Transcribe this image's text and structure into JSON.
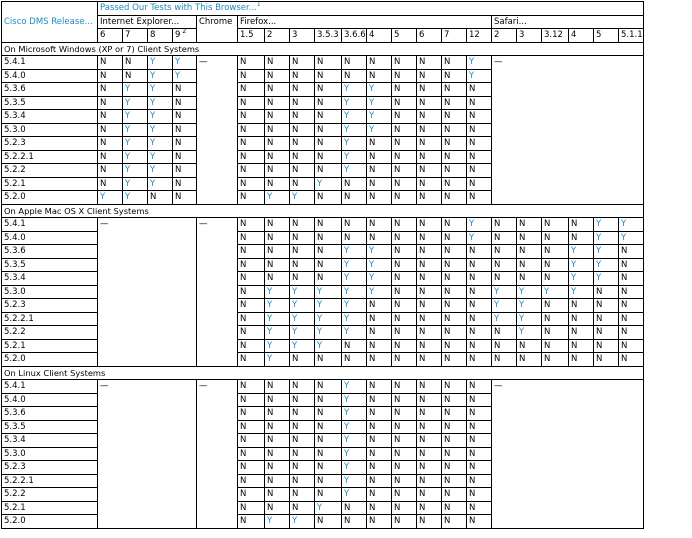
{
  "header": {
    "title": "Passed Our Tests with This Browser...",
    "title_note": "1",
    "release_label": "Cisco DMS Release...",
    "ie_label": "Internet Explorer...",
    "chrome_label": "Chrome",
    "firefox_label": "Firefox...",
    "safari_label": "Safari...",
    "ie_versions": [
      "6",
      "7",
      "8",
      "9"
    ],
    "ie9_note": "2",
    "firefox_versions": [
      "1.5",
      "2",
      "3",
      "3.5.3",
      "3.6.6",
      "4",
      "5",
      "6",
      "7",
      "12"
    ],
    "safari_versions": [
      "2",
      "3",
      "3.12",
      "4",
      "5",
      "5.1.1"
    ]
  },
  "dash": "—",
  "sections": [
    {
      "title": "On Microsoft Windows (XP or 7) Client Systems",
      "rows": [
        {
          "release": "5.4.1",
          "ie": [
            "N",
            "N",
            "Y",
            "Y"
          ],
          "chrome": "—",
          "ff": [
            "N",
            "N",
            "N",
            "N",
            "N",
            "N",
            "N",
            "N",
            "N",
            "Y"
          ],
          "safari": [
            "—"
          ]
        },
        {
          "release": "5.4.0",
          "ie": [
            "N",
            "N",
            "Y",
            "Y"
          ],
          "chrome": "",
          "ff": [
            "N",
            "N",
            "N",
            "N",
            "N",
            "N",
            "N",
            "N",
            "N",
            "Y"
          ],
          "safari": []
        },
        {
          "release": "5.3.6",
          "ie": [
            "N",
            "Y",
            "Y",
            "N"
          ],
          "chrome": "",
          "ff": [
            "N",
            "N",
            "N",
            "N",
            "Y",
            "Y",
            "N",
            "N",
            "N",
            "N"
          ],
          "safari": []
        },
        {
          "release": "5.3.5",
          "ie": [
            "N",
            "Y",
            "Y",
            "N"
          ],
          "chrome": "",
          "ff": [
            "N",
            "N",
            "N",
            "N",
            "Y",
            "Y",
            "N",
            "N",
            "N",
            "N"
          ],
          "safari": []
        },
        {
          "release": "5.3.4",
          "ie": [
            "N",
            "Y",
            "Y",
            "N"
          ],
          "chrome": "",
          "ff": [
            "N",
            "N",
            "N",
            "N",
            "Y",
            "Y",
            "N",
            "N",
            "N",
            "N"
          ],
          "safari": []
        },
        {
          "release": "5.3.0",
          "ie": [
            "N",
            "Y",
            "Y",
            "N"
          ],
          "chrome": "",
          "ff": [
            "N",
            "N",
            "N",
            "N",
            "Y",
            "Y",
            "N",
            "N",
            "N",
            "N"
          ],
          "safari": []
        },
        {
          "release": "5.2.3",
          "ie": [
            "N",
            "Y",
            "Y",
            "N"
          ],
          "chrome": "",
          "ff": [
            "N",
            "N",
            "N",
            "N",
            "Y",
            "N",
            "N",
            "N",
            "N",
            "N"
          ],
          "safari": []
        },
        {
          "release": "5.2.2.1",
          "ie": [
            "N",
            "Y",
            "Y",
            "N"
          ],
          "chrome": "",
          "ff": [
            "N",
            "N",
            "N",
            "N",
            "Y",
            "N",
            "N",
            "N",
            "N",
            "N"
          ],
          "safari": []
        },
        {
          "release": "5.2.2",
          "ie": [
            "N",
            "Y",
            "Y",
            "N"
          ],
          "chrome": "",
          "ff": [
            "N",
            "N",
            "N",
            "N",
            "Y",
            "N",
            "N",
            "N",
            "N",
            "N"
          ],
          "safari": []
        },
        {
          "release": "5.2.1",
          "ie": [
            "N",
            "Y",
            "Y",
            "N"
          ],
          "chrome": "",
          "ff": [
            "N",
            "N",
            "N",
            "Y",
            "N",
            "N",
            "N",
            "N",
            "N",
            "N"
          ],
          "safari": []
        },
        {
          "release": "5.2.0",
          "ie": [
            "Y",
            "Y",
            "N",
            "N"
          ],
          "chrome": "",
          "ff": [
            "N",
            "Y",
            "Y",
            "N",
            "N",
            "N",
            "N",
            "N",
            "N",
            "N"
          ],
          "safari": []
        }
      ]
    },
    {
      "title": "On Apple Mac OS X Client Systems",
      "rows": [
        {
          "release": "5.4.1",
          "ie": [
            "—"
          ],
          "chrome": "—",
          "ff": [
            "N",
            "N",
            "N",
            "N",
            "N",
            "N",
            "N",
            "N",
            "N",
            "Y"
          ],
          "safari": [
            "N",
            "N",
            "N",
            "N",
            "Y",
            "Y"
          ]
        },
        {
          "release": "5.4.0",
          "ie": [],
          "chrome": "",
          "ff": [
            "N",
            "N",
            "N",
            "N",
            "N",
            "N",
            "N",
            "N",
            "N",
            "Y"
          ],
          "safari": [
            "N",
            "N",
            "N",
            "N",
            "Y",
            "Y"
          ]
        },
        {
          "release": "5.3.6",
          "ie": [],
          "chrome": "",
          "ff": [
            "N",
            "N",
            "N",
            "N",
            "Y",
            "Y",
            "N",
            "N",
            "N",
            "N"
          ],
          "safari": [
            "N",
            "N",
            "N",
            "Y",
            "Y",
            "N"
          ]
        },
        {
          "release": "5.3.5",
          "ie": [],
          "chrome": "",
          "ff": [
            "N",
            "N",
            "N",
            "N",
            "Y",
            "Y",
            "N",
            "N",
            "N",
            "N"
          ],
          "safari": [
            "N",
            "N",
            "N",
            "Y",
            "Y",
            "N"
          ]
        },
        {
          "release": "5.3.4",
          "ie": [],
          "chrome": "",
          "ff": [
            "N",
            "N",
            "N",
            "N",
            "Y",
            "Y",
            "N",
            "N",
            "N",
            "N"
          ],
          "safari": [
            "N",
            "N",
            "N",
            "Y",
            "Y",
            "N"
          ]
        },
        {
          "release": "5.3.0",
          "ie": [],
          "chrome": "",
          "ff": [
            "N",
            "Y",
            "Y",
            "Y",
            "Y",
            "Y",
            "N",
            "N",
            "N",
            "N"
          ],
          "safari": [
            "Y",
            "Y",
            "Y",
            "Y",
            "N",
            "N"
          ]
        },
        {
          "release": "5.2.3",
          "ie": [],
          "chrome": "",
          "ff": [
            "N",
            "Y",
            "Y",
            "Y",
            "Y",
            "N",
            "N",
            "N",
            "N",
            "N"
          ],
          "safari": [
            "Y",
            "Y",
            "N",
            "N",
            "N",
            "N"
          ]
        },
        {
          "release": "5.2.2.1",
          "ie": [],
          "chrome": "",
          "ff": [
            "N",
            "Y",
            "Y",
            "Y",
            "Y",
            "N",
            "N",
            "N",
            "N",
            "N"
          ],
          "safari": [
            "Y",
            "Y",
            "N",
            "N",
            "N",
            "N"
          ]
        },
        {
          "release": "5.2.2",
          "ie": [],
          "chrome": "",
          "ff": [
            "N",
            "Y",
            "Y",
            "Y",
            "Y",
            "N",
            "N",
            "N",
            "N",
            "N"
          ],
          "safari": [
            "N",
            "Y",
            "N",
            "N",
            "N",
            "N"
          ]
        },
        {
          "release": "5.2.1",
          "ie": [],
          "chrome": "",
          "ff": [
            "N",
            "Y",
            "Y",
            "Y",
            "N",
            "N",
            "N",
            "N",
            "N",
            "N"
          ],
          "safari": [
            "N",
            "N",
            "N",
            "N",
            "N",
            "N"
          ]
        },
        {
          "release": "5.2.0",
          "ie": [],
          "chrome": "",
          "ff": [
            "N",
            "Y",
            "N",
            "N",
            "N",
            "N",
            "N",
            "N",
            "N",
            "N"
          ],
          "safari": [
            "N",
            "N",
            "N",
            "N",
            "N",
            "N"
          ]
        }
      ]
    },
    {
      "title": "On Linux Client Systems",
      "rows": [
        {
          "release": "5.4.1",
          "ie": [
            "—"
          ],
          "chrome": "—",
          "ff": [
            "N",
            "N",
            "N",
            "N",
            "Y",
            "N",
            "N",
            "N",
            "N",
            "N"
          ],
          "safari": [
            "—"
          ]
        },
        {
          "release": "5.4.0",
          "ie": [],
          "chrome": "",
          "ff": [
            "N",
            "N",
            "N",
            "N",
            "Y",
            "N",
            "N",
            "N",
            "N",
            "N"
          ],
          "safari": []
        },
        {
          "release": "5.3.6",
          "ie": [],
          "chrome": "",
          "ff": [
            "N",
            "N",
            "N",
            "N",
            "Y",
            "N",
            "N",
            "N",
            "N",
            "N"
          ],
          "safari": []
        },
        {
          "release": "5.3.5",
          "ie": [],
          "chrome": "",
          "ff": [
            "N",
            "N",
            "N",
            "N",
            "Y",
            "N",
            "N",
            "N",
            "N",
            "N"
          ],
          "safari": []
        },
        {
          "release": "5.3.4",
          "ie": [],
          "chrome": "",
          "ff": [
            "N",
            "N",
            "N",
            "N",
            "Y",
            "N",
            "N",
            "N",
            "N",
            "N"
          ],
          "safari": []
        },
        {
          "release": "5.3.0",
          "ie": [],
          "chrome": "",
          "ff": [
            "N",
            "N",
            "N",
            "N",
            "Y",
            "N",
            "N",
            "N",
            "N",
            "N"
          ],
          "safari": []
        },
        {
          "release": "5.2.3",
          "ie": [],
          "chrome": "",
          "ff": [
            "N",
            "N",
            "N",
            "N",
            "Y",
            "N",
            "N",
            "N",
            "N",
            "N"
          ],
          "safari": []
        },
        {
          "release": "5.2.2.1",
          "ie": [],
          "chrome": "",
          "ff": [
            "N",
            "N",
            "N",
            "N",
            "Y",
            "N",
            "N",
            "N",
            "N",
            "N"
          ],
          "safari": []
        },
        {
          "release": "5.2.2",
          "ie": [],
          "chrome": "",
          "ff": [
            "N",
            "N",
            "N",
            "N",
            "Y",
            "N",
            "N",
            "N",
            "N",
            "N"
          ],
          "safari": []
        },
        {
          "release": "5.2.1",
          "ie": [],
          "chrome": "",
          "ff": [
            "N",
            "N",
            "N",
            "Y",
            "N",
            "N",
            "N",
            "N",
            "N",
            "N"
          ],
          "safari": []
        },
        {
          "release": "5.2.0",
          "ie": [],
          "chrome": "",
          "ff": [
            "N",
            "Y",
            "Y",
            "N",
            "N",
            "N",
            "N",
            "N",
            "N",
            "N"
          ],
          "safari": []
        }
      ]
    }
  ],
  "colors": {
    "accent": "#1e8bbf",
    "text": "#000000",
    "border": "#000000"
  }
}
